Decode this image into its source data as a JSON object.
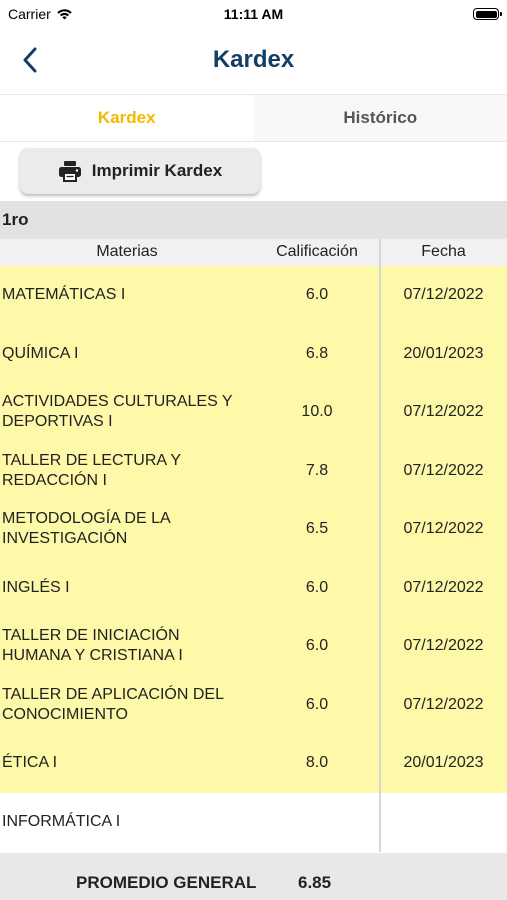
{
  "status_bar": {
    "carrier": "Carrier",
    "time": "11:11 AM"
  },
  "nav": {
    "title": "Kardex",
    "back_icon": "chevron-left-icon"
  },
  "tabs": [
    {
      "label": "Kardex",
      "active": true
    },
    {
      "label": "Histórico",
      "active": false
    }
  ],
  "print_button": {
    "label": "Imprimir Kardex",
    "icon": "printer-icon"
  },
  "section": {
    "title": "1ro"
  },
  "table": {
    "headers": {
      "materias": "Materias",
      "calificacion": "Calificación",
      "fecha": "Fecha"
    },
    "rows": [
      {
        "materia": "MATEMÁTICAS I",
        "calificacion": "6.0",
        "fecha": "07/12/2022"
      },
      {
        "materia": "QUÍMICA I",
        "calificacion": "6.8",
        "fecha": "20/01/2023"
      },
      {
        "materia": "ACTIVIDADES CULTURALES Y DEPORTIVAS I",
        "calificacion": "10.0",
        "fecha": "07/12/2022"
      },
      {
        "materia": "TALLER DE LECTURA Y REDACCIÓN I",
        "calificacion": "7.8",
        "fecha": "07/12/2022"
      },
      {
        "materia": "METODOLOGÍA DE LA INVESTIGACIÓN",
        "calificacion": "6.5",
        "fecha": "07/12/2022"
      },
      {
        "materia": "INGLÉS I",
        "calificacion": "6.0",
        "fecha": "07/12/2022"
      },
      {
        "materia": "TALLER DE INICIACIÓN HUMANA Y CRISTIANA I",
        "calificacion": "6.0",
        "fecha": "07/12/2022"
      },
      {
        "materia": "TALLER DE APLICACIÓN DEL CONOCIMIENTO",
        "calificacion": "6.0",
        "fecha": "07/12/2022"
      },
      {
        "materia": "ÉTICA I",
        "calificacion": "8.0",
        "fecha": "20/01/2023"
      },
      {
        "materia": "INFORMÁTICA I",
        "calificacion": "",
        "fecha": ""
      }
    ]
  },
  "footer": {
    "label": "PROMEDIO GENERAL",
    "value": "6.85"
  },
  "colors": {
    "title": "#133f66",
    "active_tab": "#f5b800",
    "row_highlight": "#fdf9a8"
  }
}
